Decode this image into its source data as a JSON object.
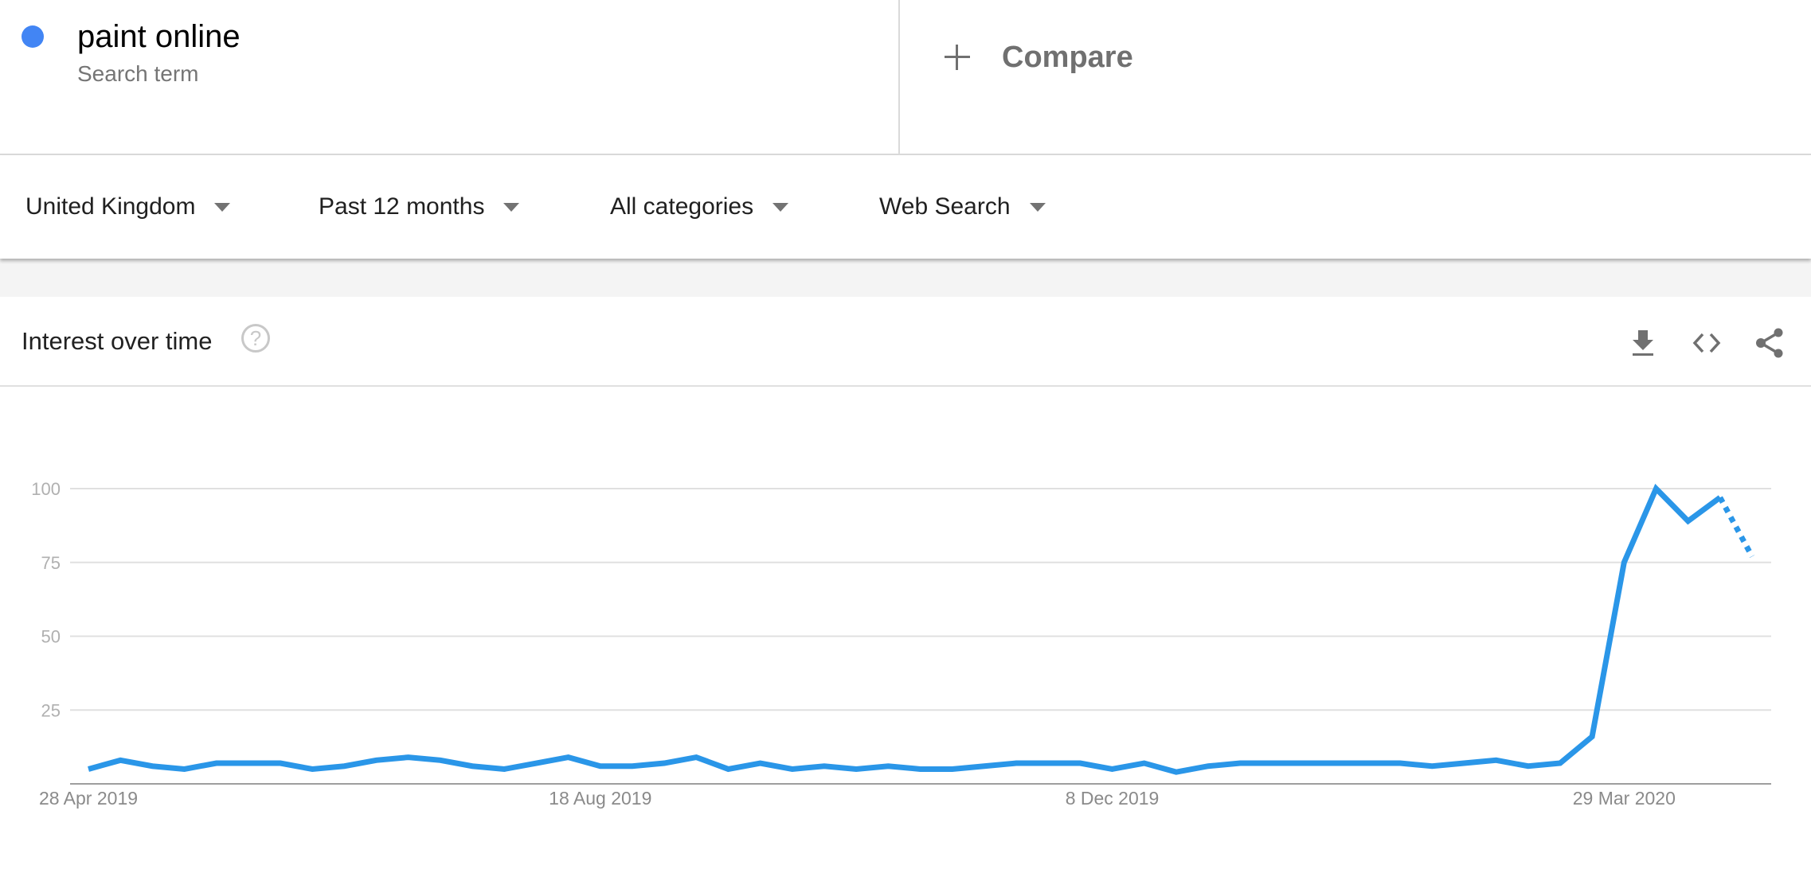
{
  "search_term": {
    "title": "paint online",
    "subtitle": "Search term",
    "color": "#4285F4"
  },
  "compare": {
    "label": "Compare",
    "icon": "plus-icon"
  },
  "filters": [
    {
      "label": "United Kingdom",
      "icon": "caret-down-icon"
    },
    {
      "label": "Past 12 months",
      "icon": "caret-down-icon"
    },
    {
      "label": "All categories",
      "icon": "caret-down-icon"
    },
    {
      "label": "Web Search",
      "icon": "caret-down-icon"
    }
  ],
  "card": {
    "title": "Interest over time",
    "help_icon": "?",
    "tools": [
      "download-icon",
      "embed-code-icon",
      "share-icon"
    ]
  },
  "chart_data": {
    "type": "line",
    "title": "Interest over time",
    "xlabel": "",
    "ylabel": "",
    "ylim": [
      0,
      100
    ],
    "y_ticks": [
      25,
      50,
      75,
      100
    ],
    "x_tick_labels": [
      {
        "index": 0,
        "label": "28 Apr 2019"
      },
      {
        "index": 16,
        "label": "18 Aug 2019"
      },
      {
        "index": 32,
        "label": "8 Dec 2019"
      },
      {
        "index": 48,
        "label": "29 Mar 2020"
      }
    ],
    "grid": true,
    "series": [
      {
        "name": "paint online",
        "color": "#2a96e8",
        "values": [
          5,
          8,
          6,
          5,
          7,
          7,
          7,
          5,
          6,
          8,
          9,
          8,
          6,
          5,
          7,
          9,
          6,
          6,
          7,
          9,
          5,
          7,
          5,
          6,
          5,
          6,
          5,
          5,
          6,
          7,
          7,
          7,
          5,
          7,
          4,
          6,
          7,
          7,
          7,
          7,
          7,
          7,
          6,
          7,
          8,
          6,
          7,
          16,
          75,
          100,
          89,
          97,
          77
        ],
        "partial_from_index": 51
      }
    ]
  }
}
